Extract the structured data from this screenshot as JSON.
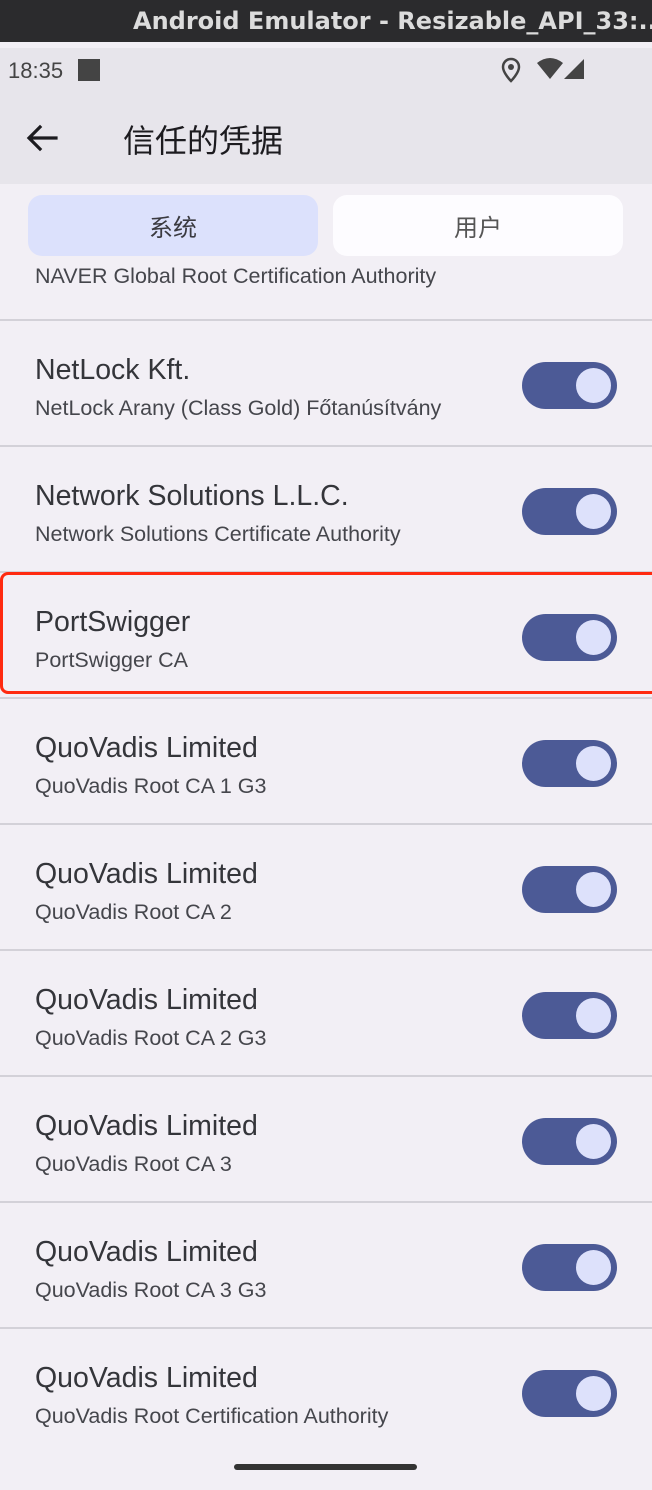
{
  "window": {
    "title": "Android Emulator - Resizable_API_33:..."
  },
  "status_bar": {
    "time": "18:35"
  },
  "app_bar": {
    "title": "信任的凭据"
  },
  "tabs": [
    {
      "label": "系统",
      "selected": true
    },
    {
      "label": "用户",
      "selected": false
    }
  ],
  "partial_item": {
    "subtitle": "NAVER Global Root Certification Authority"
  },
  "certificates": [
    {
      "title": "NetLock Kft.",
      "subtitle": "NetLock Arany (Class Gold) Főtanúsítvány",
      "enabled": true
    },
    {
      "title": "Network Solutions L.L.C.",
      "subtitle": "Network Solutions Certificate Authority",
      "enabled": true
    },
    {
      "title": "PortSwigger",
      "subtitle": "PortSwigger CA",
      "enabled": true,
      "highlighted": true
    },
    {
      "title": "QuoVadis Limited",
      "subtitle": "QuoVadis Root CA 1 G3",
      "enabled": true
    },
    {
      "title": "QuoVadis Limited",
      "subtitle": "QuoVadis Root CA 2",
      "enabled": true
    },
    {
      "title": "QuoVadis Limited",
      "subtitle": "QuoVadis Root CA 2 G3",
      "enabled": true
    },
    {
      "title": "QuoVadis Limited",
      "subtitle": "QuoVadis Root CA 3",
      "enabled": true
    },
    {
      "title": "QuoVadis Limited",
      "subtitle": "QuoVadis Root CA 3 G3",
      "enabled": true
    },
    {
      "title": "QuoVadis Limited",
      "subtitle": "QuoVadis Root Certification Authority",
      "enabled": true
    }
  ],
  "colors": {
    "toggle_track": "#4c5a96",
    "toggle_thumb": "#dde1fb",
    "tab_selected": "#dce1fc",
    "highlight_border": "#ff2a10"
  }
}
